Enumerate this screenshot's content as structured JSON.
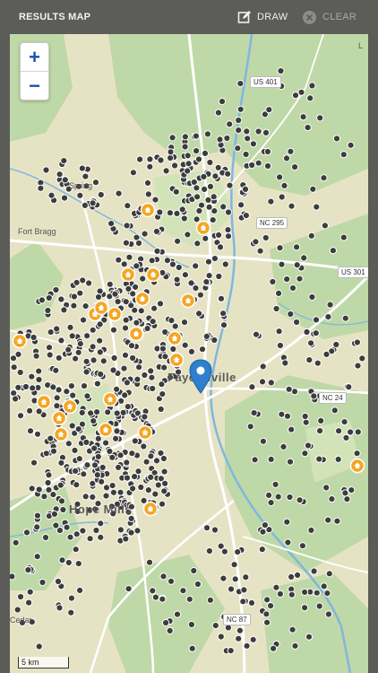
{
  "header": {
    "title": "RESULTS MAP",
    "draw_label": "DRAW",
    "clear_label": "CLEAR",
    "draw_icon": "pencil-square-icon",
    "clear_icon": "x-circle-icon"
  },
  "map": {
    "zoom_in": "+",
    "zoom_out": "−",
    "scale_label": "5 km",
    "place_labels": [
      "Fort Bragg",
      "Spring",
      "Cedar",
      "Fayetteville",
      "Hope Mills",
      "L"
    ],
    "route_labels": [
      "US 401",
      "NC 295",
      "US 301",
      "NC 24",
      "NC 87"
    ],
    "colors": {
      "forest": "#bfd8a7",
      "land": "#e6e3c5",
      "river": "#7fb7dd",
      "road": "#ffffff",
      "home_marker": "#f5a623",
      "listing_marker": "#3d3d3d",
      "location_pin": "#2e7fd0"
    }
  }
}
